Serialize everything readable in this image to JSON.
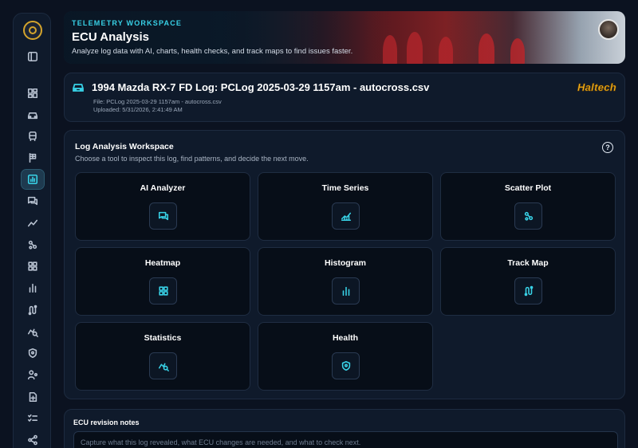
{
  "hero": {
    "eyebrow": "Telemetry Workspace",
    "title": "ECU Analysis",
    "subtitle": "Analyze log data with AI, charts, health checks, and track maps to find issues faster."
  },
  "log": {
    "title": "1994 Mazda RX-7 FD Log: PCLog 2025-03-29 1157am - autocross.csv",
    "file": "File: PCLog 2025-03-29 1157am - autocross.csv",
    "uploaded": "Uploaded: 5/31/2026, 2:41:49 AM",
    "brand": "Haltech"
  },
  "workspace": {
    "title": "Log Analysis Workspace",
    "subtitle": "Choose a tool to inspect this log, find patterns, and decide the next move.",
    "help": "?",
    "tools": [
      {
        "label": "AI Analyzer",
        "icon": "chat-icon"
      },
      {
        "label": "Time Series",
        "icon": "area-chart-icon"
      },
      {
        "label": "Scatter Plot",
        "icon": "scatter-icon"
      },
      {
        "label": "Heatmap",
        "icon": "grid-icon"
      },
      {
        "label": "Histogram",
        "icon": "bar-chart-icon"
      },
      {
        "label": "Track Map",
        "icon": "route-icon"
      },
      {
        "label": "Statistics",
        "icon": "chart-search-icon"
      },
      {
        "label": "Health",
        "icon": "shield-icon"
      }
    ]
  },
  "notes": {
    "title": "ECU revision notes",
    "placeholder": "Capture what this log revealed, what ECU changes are needed, and what to check next."
  },
  "sidebar": {
    "items": [
      "panel-toggle-icon",
      "dashboard-icon",
      "car-icon",
      "vehicle-icon",
      "flag-icon",
      "analysis-icon",
      "chat-icon",
      "line-chart-icon",
      "scatter-icon",
      "grid-icon",
      "bar-chart-icon",
      "route-icon",
      "chart-search-icon",
      "shield-icon",
      "user-settings-icon",
      "file-add-icon",
      "checklist-icon",
      "share-icon"
    ],
    "active": "analysis-icon"
  },
  "colors": {
    "accent": "#38d1e6",
    "background": "#0b1220",
    "card": "#0f1a2b",
    "brand": "#f5b41f"
  }
}
